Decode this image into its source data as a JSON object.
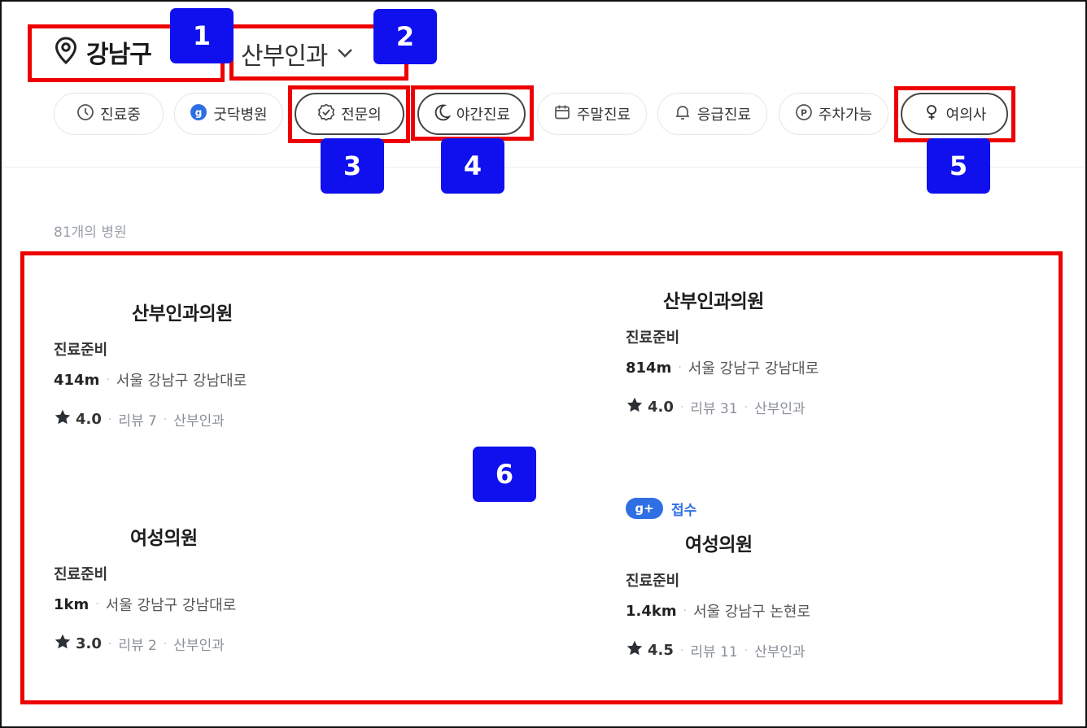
{
  "header": {
    "location": "강남구",
    "department": "산부인과"
  },
  "filters": [
    {
      "label": "진료중",
      "icon": "clock-icon"
    },
    {
      "label": "굿닥병원",
      "icon": "goodoc-badge-icon"
    },
    {
      "label": "전문의",
      "icon": "verified-check-icon"
    },
    {
      "label": "야간진료",
      "icon": "moon-icon"
    },
    {
      "label": "주말진료",
      "icon": "calendar-icon"
    },
    {
      "label": "응급진료",
      "icon": "bell-icon"
    },
    {
      "label": "주차가능",
      "icon": "parking-icon"
    },
    {
      "label": "여의사",
      "icon": "female-icon"
    }
  ],
  "results": {
    "count_text": "81개의 병원"
  },
  "hospitals": [
    {
      "name": "산부인과의원",
      "status": "진료준비",
      "distance": "414m",
      "address": "서울 강남구 강남대로",
      "rating": "4.0",
      "reviews": "리뷰 7",
      "category": "산부인과"
    },
    {
      "name": "산부인과의원",
      "status": "진료준비",
      "distance": "814m",
      "address": "서울 강남구 강남대로",
      "rating": "4.0",
      "reviews": "리뷰 31",
      "category": "산부인과"
    },
    {
      "name": "여성의원",
      "status": "진료준비",
      "distance": "1km",
      "address": "서울 강남구 강남대로",
      "rating": "3.0",
      "reviews": "리뷰 2",
      "category": "산부인과"
    },
    {
      "name": "여성의원",
      "status": "진료준비",
      "distance": "1.4km",
      "address": "서울 강남구 논현로",
      "rating": "4.5",
      "reviews": "리뷰 11",
      "category": "산부인과",
      "badge": "g+",
      "badge_text": "접수"
    }
  ],
  "annotations": [
    "1",
    "2",
    "3",
    "4",
    "5",
    "6"
  ],
  "colors": {
    "annotation_box": "#ee0000",
    "annotation_label": "#1010ee",
    "accent_blue": "#2f6fe4"
  }
}
